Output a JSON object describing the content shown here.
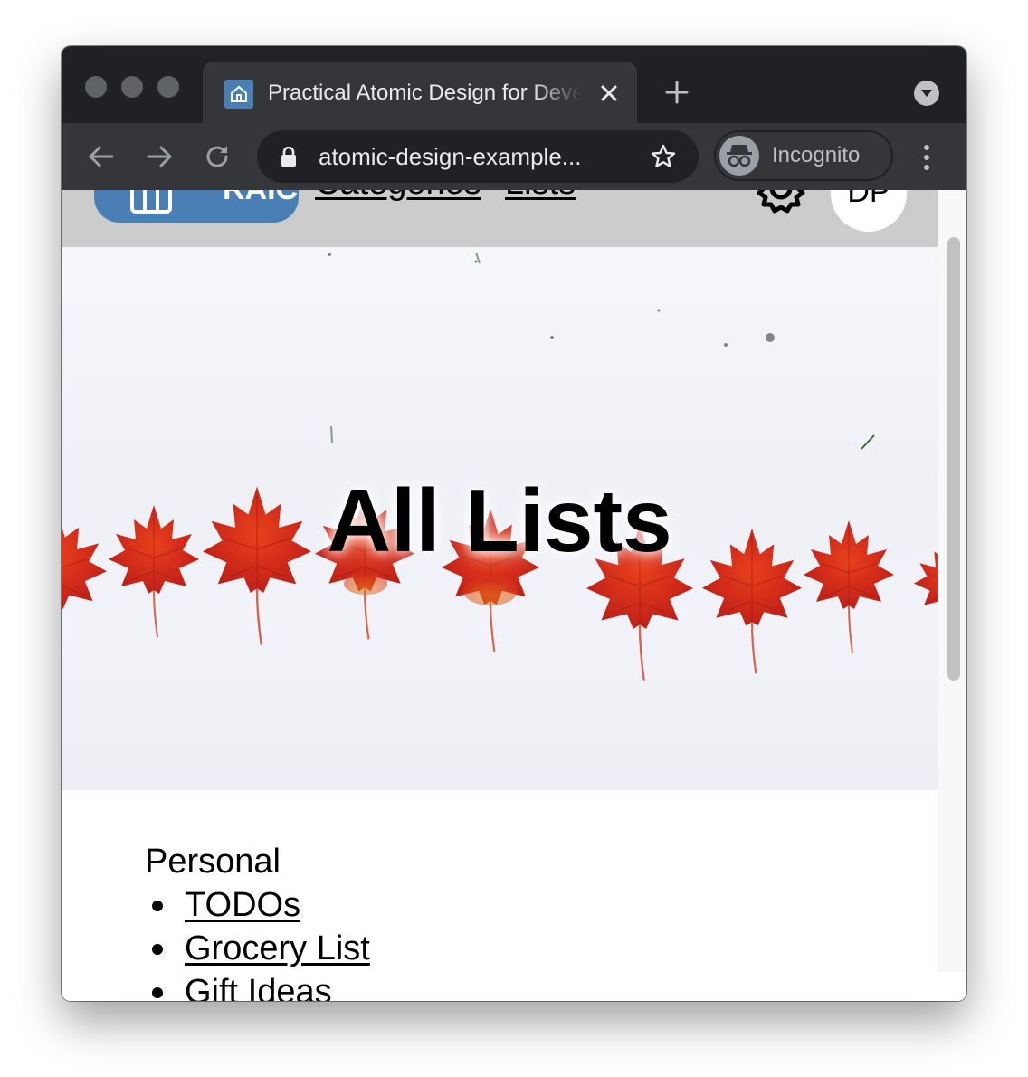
{
  "browser": {
    "tab": {
      "title": "Practical Atomic Design for Developers",
      "favicon": "home-icon"
    },
    "address_bar": {
      "url": "atomic-design-example..."
    },
    "profile": {
      "label": "Incognito",
      "icon": "incognito-icon"
    },
    "colors": {
      "frame": "#202124",
      "toolbar": "#35363a"
    }
  },
  "site": {
    "header": {
      "logo_text": "RAIC",
      "nav": [
        "Categories",
        "Lists"
      ],
      "settings_icon": "gear-icon",
      "user_initials": "DP",
      "background": "#cccccc",
      "logo_color": "#4a7fb5"
    },
    "hero": {
      "title": "All Lists"
    },
    "lists": {
      "group": "Personal",
      "items": [
        "TODOs",
        "Grocery List",
        "Gift Ideas"
      ]
    }
  }
}
